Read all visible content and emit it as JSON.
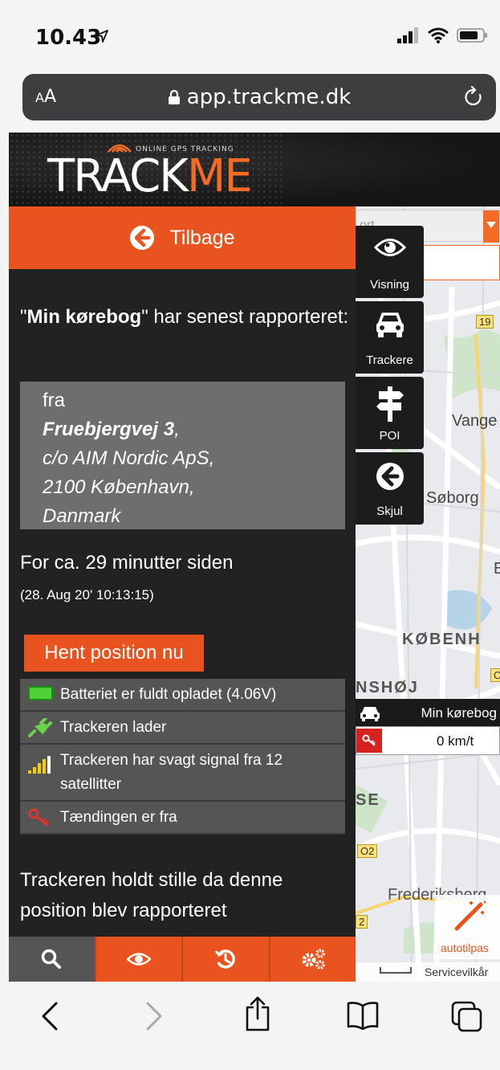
{
  "status_bar": {
    "time": "10.43",
    "icons": [
      "location-arrow-icon",
      "cellular-signal-icon",
      "wifi-icon",
      "battery-icon"
    ]
  },
  "browser": {
    "text_size_label_small": "A",
    "text_size_label_large": "A",
    "url": "app.trackme.dk",
    "icons": [
      "lock-icon",
      "reload-icon"
    ]
  },
  "header": {
    "logo_track": "TRACK",
    "logo_me": "ME",
    "logo_tagline": "ONLINE GPS TRACKING"
  },
  "panel": {
    "back_label": "Tilbage",
    "summary_name": "Min kørebog",
    "summary_quote_open": "\"",
    "summary_quote_close": "\"",
    "summary_rest": " har senest rapporteret:",
    "address": {
      "prefix": "fra",
      "street": "Fruebjergvej 3",
      "line2": "c/o AIM Nordic ApS,",
      "line3": "2100 København,",
      "line4": "Danmark"
    },
    "since": "For ca. 29 minutter siden",
    "since_date": "(28. Aug 20' 10:13:15)",
    "fetch_button": "Hent position nu",
    "statuses": [
      {
        "icon": "battery-full-icon",
        "text": "Batteriet er fuldt opladet (4.06V)"
      },
      {
        "icon": "plug-icon",
        "text": "Trackeren lader"
      },
      {
        "icon": "signal-bars-icon",
        "text": "Trackeren har svagt signal fra 12 satellitter"
      },
      {
        "icon": "key-icon",
        "text": "Tændingen er fra"
      }
    ],
    "still_text": "Trackeren holdt stille da denne position blev rapporteret",
    "tabs": [
      "search-icon",
      "eye-icon",
      "history-icon",
      "settings-gears-icon"
    ]
  },
  "tools": [
    {
      "label": "Visning",
      "icon": "eye-icon"
    },
    {
      "label": "Trackere",
      "icon": "car-icon"
    },
    {
      "label": "POI",
      "icon": "signpost-icon"
    },
    {
      "label": "Skjul",
      "icon": "arrow-left-circle-icon"
    }
  ],
  "map": {
    "select_text": "ort",
    "labels": [
      "Vange",
      "Søborg",
      "E"
    ],
    "bold_labels": [
      "KØBENH",
      "NSHØJ",
      "SE"
    ],
    "badges": [
      "19",
      "O",
      "O2",
      "2"
    ],
    "frederiksberg": "Frederiksberg",
    "autofit_label": "autotilpas",
    "footer_text": "Servicevilkår",
    "tracker_card": {
      "name": "Min kørebog",
      "speed": "0 km/t"
    }
  },
  "toolbar": {
    "icons": [
      "back-chevron-icon",
      "forward-chevron-icon",
      "share-icon",
      "bookmarks-icon",
      "tabs-icon"
    ]
  }
}
